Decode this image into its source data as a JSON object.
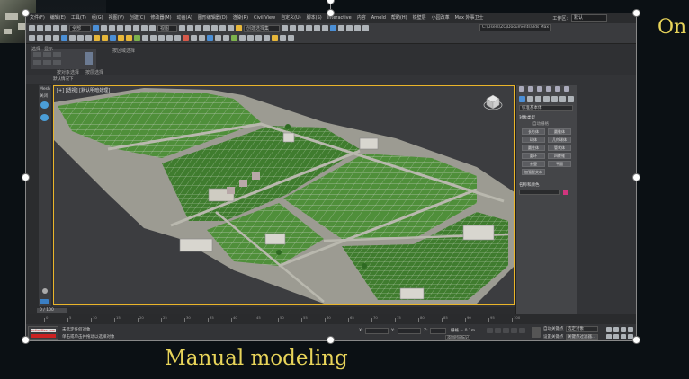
{
  "captions": {
    "bottom": "Manual modeling",
    "right": "On"
  },
  "menu": {
    "items": [
      "文件(F)",
      "编辑(E)",
      "工具(T)",
      "组(G)",
      "视图(V)",
      "创建(C)",
      "修改器(M)",
      "动画(A)",
      "图形编辑器(D)",
      "渲染(R)",
      "Civil View",
      "自定义(U)",
      "脚本(S)",
      "Interactive",
      "内容",
      "Arnold",
      "帮助(H)",
      "铁壁层",
      "小园改革",
      "Max 外事卫士"
    ],
    "workspace_label": "工作区:",
    "workspace_value": "默认"
  },
  "toolbar": {
    "undo_icon": "undo-icon",
    "redo_icon": "redo-icon",
    "filter_value": "全部",
    "view_value": "视图",
    "selection_set_value": "创建选择集",
    "project_path": "C:\\Users\\ZC\\Documents\\3ds Max 2020"
  },
  "ribbon": {
    "tab1": "选择",
    "tab2": "显示",
    "tab3": "按对象选择",
    "tab4": "按层选择",
    "tab5": "按区域选择"
  },
  "scene": {
    "label": "默认情况下"
  },
  "viewport": {
    "label": "[+] [透视] [默认明暗处理]",
    "left_label": "Mesh",
    "left_label2": "关闭"
  },
  "command_panel": {
    "dropdown": "标准基本体",
    "section_type": "对象类型",
    "autogrid": "自动栅格",
    "buttons": [
      "长方体",
      "圆锥体",
      "球体",
      "几何球体",
      "圆柱体",
      "管状体",
      "圆环",
      "四棱锥",
      "茶壶",
      "平面",
      "加强型文本"
    ],
    "section_name": "名称和颜色",
    "swatch_color": "#d1357e"
  },
  "timeline": {
    "position": "0 / 100",
    "ticks": [
      "0",
      "5",
      "10",
      "15",
      "20",
      "25",
      "30",
      "35",
      "40",
      "45",
      "50",
      "55",
      "60",
      "65",
      "70",
      "75",
      "80",
      "85",
      "90",
      "95",
      "100"
    ]
  },
  "status": {
    "max_logo_text": "actionMax.com",
    "message1": "未选定任何对象",
    "message2": "单击或单击并拖动以选择对象",
    "x_label": "X:",
    "y_label": "Y:",
    "z_label": "Z:",
    "grid": "栅格 = 0.1m",
    "add_time_tag": "添加时间标记",
    "auto_key": "自动关键点",
    "set_key": "设置关键点",
    "key_field": "选定对象",
    "key_filters": "关键点过滤器..."
  },
  "colors": {
    "accent_caption": "#e8d45a",
    "viewport_border": "#eab52a",
    "grass": "#4f8f3a"
  }
}
